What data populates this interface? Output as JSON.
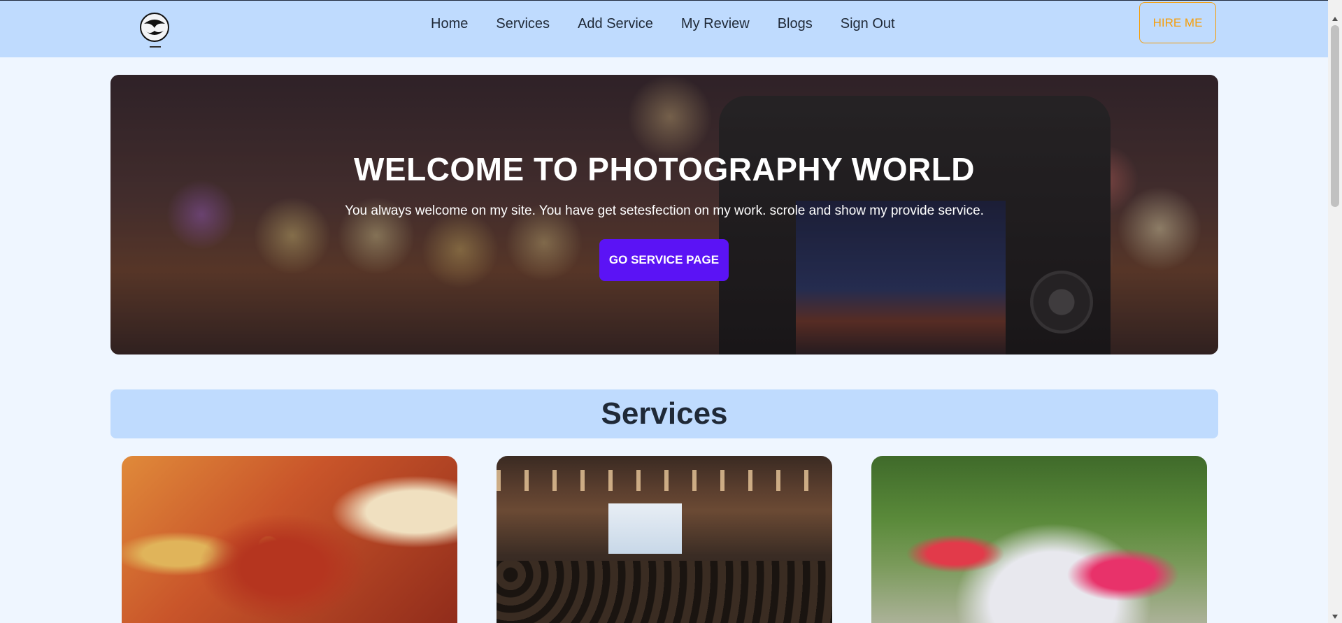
{
  "nav": {
    "logo_icon": "camera-mask-logo",
    "links": [
      "Home",
      "Services",
      "Add Service",
      "My Review",
      "Blogs",
      "Sign Out"
    ],
    "hire_label": "HIRE ME"
  },
  "hero": {
    "title": "WELCOME TO PHOTOGRAPHY WORLD",
    "subtitle": "You always welcome on my site. You have get setesfection on my work. scrole and show my provide service.",
    "button_label": "GO SERVICE PAGE"
  },
  "services": {
    "heading": "Services",
    "cards": [
      {
        "image": "wedding-hands-photo"
      },
      {
        "image": "conference-hall-photo"
      },
      {
        "image": "outdoor-cooking-photo"
      }
    ]
  },
  "colors": {
    "nav_bg": "#bfdbfe",
    "page_bg": "#eff6ff",
    "accent_button": "#5b13f5",
    "hire_border": "#f59e0b"
  }
}
